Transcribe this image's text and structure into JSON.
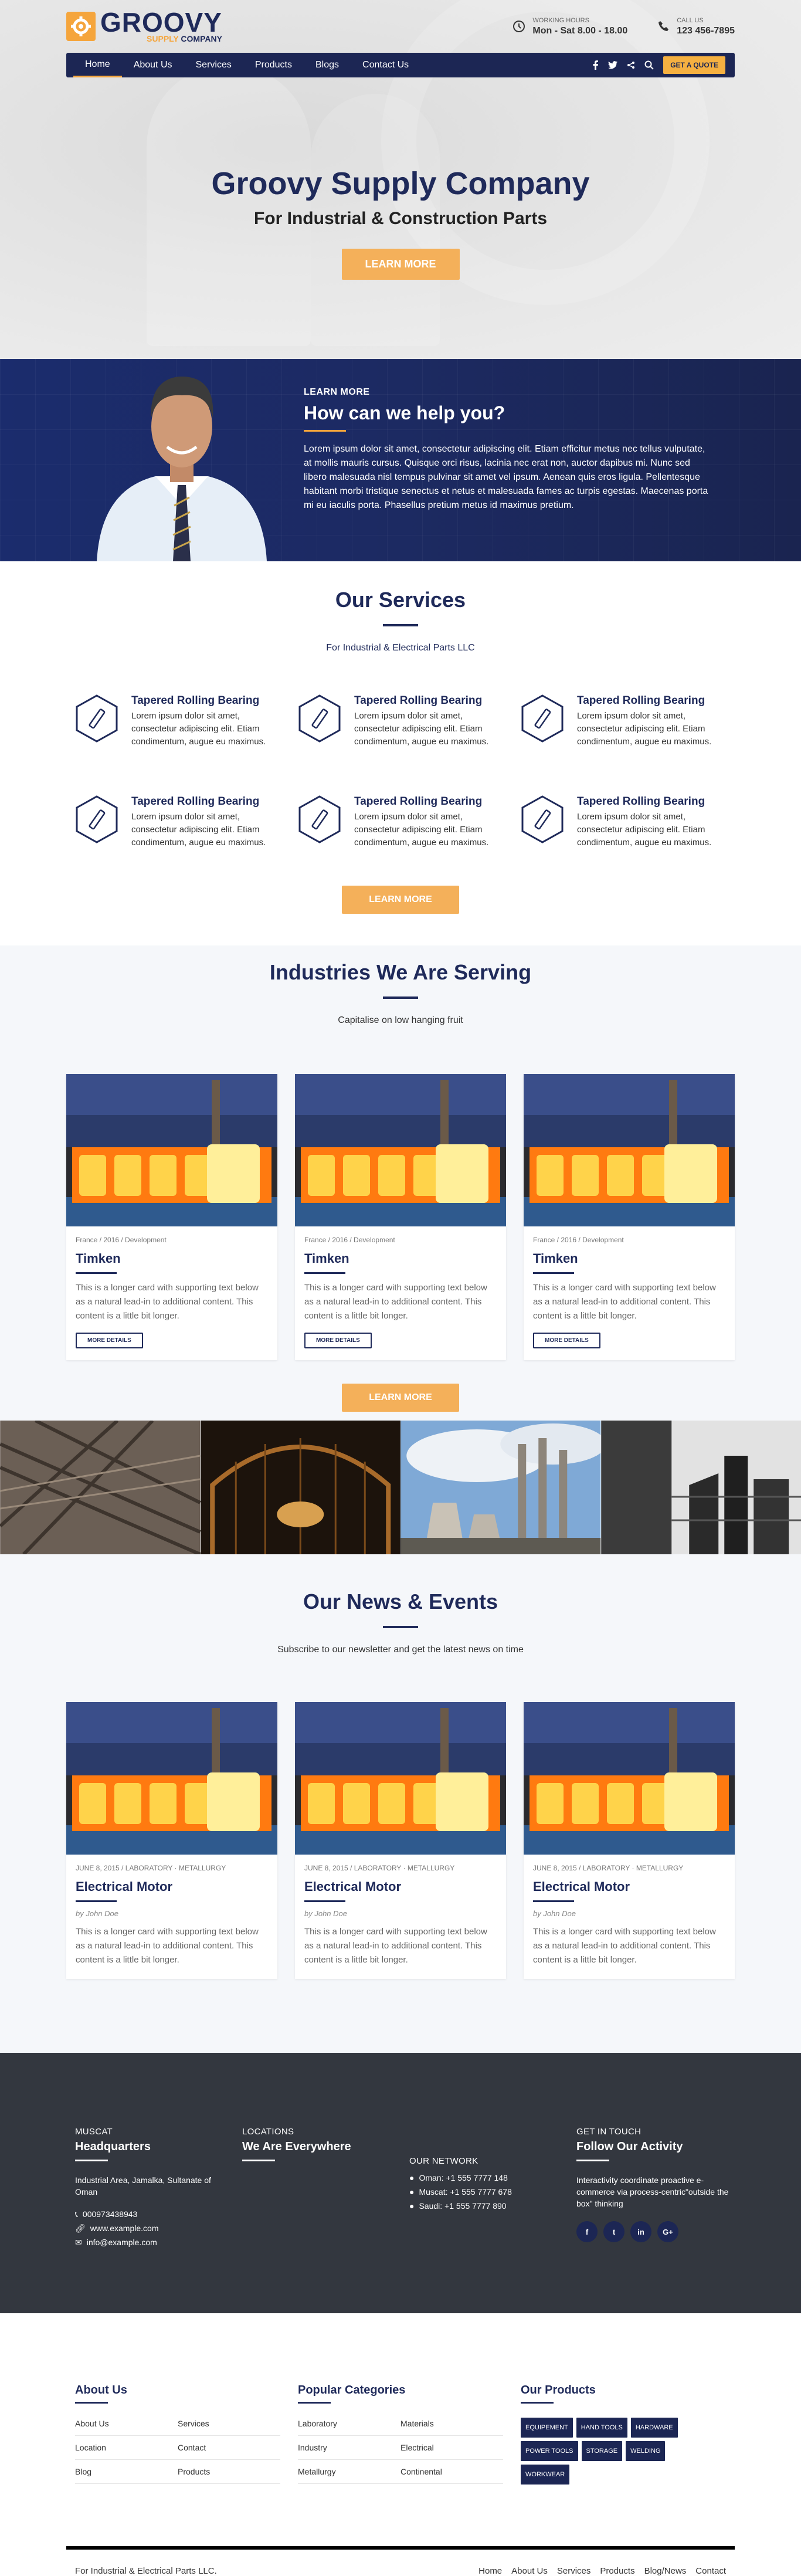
{
  "header": {
    "logo_main": "GROOVY",
    "logo_sub_colored": "SUPPLY",
    "logo_sub": "COMPANY",
    "hours_label": "WORKING HOURS",
    "hours_value": "Mon - Sat 8.00 - 18.00",
    "call_label": "CALL US",
    "call_value": "123 456-7895"
  },
  "nav": {
    "items": [
      {
        "label": "Home"
      },
      {
        "label": "About Us"
      },
      {
        "label": "Services"
      },
      {
        "label": "Products"
      },
      {
        "label": "Blogs"
      },
      {
        "label": "Contact Us"
      }
    ],
    "quote_label": "GET A QUOTE"
  },
  "hero": {
    "title": "Groovy Supply Company",
    "subtitle": "For Industrial & Construction Parts",
    "button": "LEARN MORE"
  },
  "help": {
    "kicker": "LEARN MORE",
    "title": "How can we help you?",
    "text": "Lorem ipsum dolor sit amet, consectetur adipiscing elit. Etiam efficitur metus nec tellus vulputate, at mollis mauris cursus. Quisque orci risus, lacinia nec erat non, auctor dapibus mi. Nunc sed libero malesuada nisl tempus pulvinar sit amet vel ipsum. Aenean quis eros ligula. Pellentesque habitant morbi tristique senectus et netus et malesuada fames ac turpis egestas. Maecenas porta mi eu iaculis porta. Phasellus pretium metus id maximus pretium."
  },
  "services": {
    "title": "Our Services",
    "subtitle": "For Industrial & Electrical Parts LLC",
    "items": [
      {
        "title": "Tapered Rolling Bearing",
        "text": "Lorem ipsum dolor sit amet, consectetur adipiscing elit. Etiam condimentum, augue eu maximus."
      },
      {
        "title": "Tapered Rolling Bearing",
        "text": "Lorem ipsum dolor sit amet, consectetur adipiscing elit. Etiam condimentum, augue eu maximus."
      },
      {
        "title": "Tapered Rolling Bearing",
        "text": "Lorem ipsum dolor sit amet, consectetur adipiscing elit. Etiam condimentum, augue eu maximus."
      },
      {
        "title": "Tapered Rolling Bearing",
        "text": "Lorem ipsum dolor sit amet, consectetur adipiscing elit. Etiam condimentum, augue eu maximus."
      },
      {
        "title": "Tapered Rolling Bearing",
        "text": "Lorem ipsum dolor sit amet, consectetur adipiscing elit. Etiam condimentum, augue eu maximus."
      },
      {
        "title": "Tapered Rolling Bearing",
        "text": "Lorem ipsum dolor sit amet, consectetur adipiscing elit. Etiam condimentum, augue eu maximus."
      }
    ],
    "button": "LEARN MORE"
  },
  "industries": {
    "title": "Industries We Are Serving",
    "subtitle": "Capitalise on low hanging fruit",
    "cards": [
      {
        "meta": "France / 2016 / Development",
        "title": "Timken",
        "text": "This is a longer card with supporting text below as a natural lead-in to additional content. This content is a little bit longer.",
        "button": "MORE DETAILS"
      },
      {
        "meta": "France / 2016 / Development",
        "title": "Timken",
        "text": "This is a longer card with supporting text below as a natural lead-in to additional content. This content is a little bit longer.",
        "button": "MORE DETAILS"
      },
      {
        "meta": "France / 2016 / Development",
        "title": "Timken",
        "text": "This is a longer card with supporting text below as a natural lead-in to additional content. This content is a little bit longer.",
        "button": "MORE DETAILS"
      }
    ],
    "button": "LEARN MORE"
  },
  "news": {
    "title": "Our News & Events",
    "subtitle": "Subscribe to our newsletter and get the latest news on time",
    "cards": [
      {
        "meta": "JUNE 8, 2015 / LABORATORY · METALLURGY",
        "title": "Electrical Motor",
        "author": "by John Doe",
        "text": "This is a longer card with supporting text below as a natural lead-in to additional content. This content is a little bit longer."
      },
      {
        "meta": "JUNE 8, 2015 / LABORATORY · METALLURGY",
        "title": "Electrical Motor",
        "author": "by John Doe",
        "text": "This is a longer card with supporting text below as a natural lead-in to additional content. This content is a little bit longer."
      },
      {
        "meta": "JUNE 8, 2015 / LABORATORY · METALLURGY",
        "title": "Electrical Motor",
        "author": "by John Doe",
        "text": "This is a longer card with supporting text below as a natural lead-in to additional content. This content is a little bit longer."
      }
    ]
  },
  "footer": {
    "hq_label": "MUSCAT",
    "hq_title": "Headquarters",
    "hq_address": "Industrial Area, Jamalka, Sultanate of Oman",
    "hq_phone": "000973438943",
    "hq_web": "www.example.com",
    "hq_email": "info@example.com",
    "loc_label": "LOCATIONS",
    "loc_title": "We Are Everywhere",
    "network_label": "OUR NETWORK",
    "network": [
      "Oman: +1 555 7777 148",
      "Muscat: +1 555 7777 678",
      "Saudi: +1 555 7777 890"
    ],
    "touch_label": "GET IN TOUCH",
    "touch_title": "Follow Our Activity",
    "touch_text": "Interactivity coordinate proactive e-commerce via process-centric\"outside the box\" thinking",
    "socials": [
      "f",
      "t",
      "in",
      "G+"
    ]
  },
  "footer_light": {
    "about_title": "About Us",
    "about_links": [
      "About Us",
      "Services",
      "Location",
      "Contact",
      "Blog",
      "Products"
    ],
    "cat_title": "Popular Categories",
    "cat_links": [
      "Laboratory",
      "Materials",
      "Industry",
      "Electrical",
      "Metallurgy",
      "Continental"
    ],
    "prod_title": "Our Products",
    "tags": [
      "EQUIPEMENT",
      "HAND TOOLS",
      "HARDWARE",
      "POWER TOOLS",
      "STORAGE",
      "WELDING",
      "WORKWEAR"
    ],
    "copyright": "For Industrial & Electrical Parts LLC.",
    "bottom_nav": [
      "Home",
      "About Us",
      "Services",
      "Products",
      "Blog/News",
      "Contact"
    ]
  },
  "colors": {
    "navy": "#1c2654",
    "orange": "#f5a53c",
    "dark_footer": "#33373f"
  }
}
